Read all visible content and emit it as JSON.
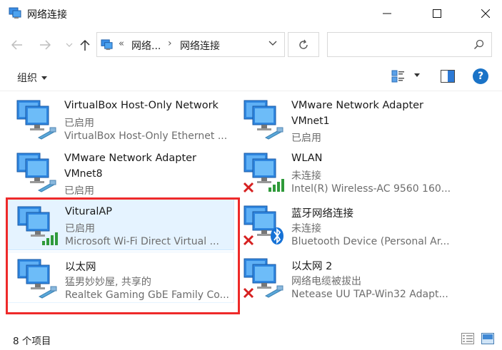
{
  "window": {
    "title": "网络连接",
    "controls": [
      "minimize-icon",
      "maximize-icon",
      "close-icon"
    ]
  },
  "address": {
    "separator": "«",
    "crumbs": [
      "网络...",
      "网络连接"
    ],
    "chevron": "›"
  },
  "search": {
    "placeholder": "",
    "value": ""
  },
  "toolbar": {
    "organize_label": "组织",
    "help_label": "?"
  },
  "colors": {
    "highlight_border": "#ee2a2a",
    "selection_bg": "#e5f3ff",
    "help_blue": "#1a73c7"
  },
  "items": [
    {
      "name": "VirtualBox Host-Only Network",
      "status": "已启用",
      "device": "VirtualBox Host-Only Ethernet ...",
      "icon": "ethernet-adapter-icon",
      "state": "enabled"
    },
    {
      "name": "VMware Network Adapter",
      "name2": "VMnet1",
      "status": "已启用",
      "icon": "ethernet-adapter-icon",
      "state": "enabled"
    },
    {
      "name": "VMware Network Adapter",
      "name2": "VMnet8",
      "status": "已启用",
      "icon": "ethernet-adapter-icon",
      "state": "enabled"
    },
    {
      "name": "WLAN",
      "status": "未连接",
      "device": "Intel(R) Wireless-AC 9560 160...",
      "icon": "wifi-adapter-icon",
      "state": "disconnected"
    },
    {
      "name": "VituralAP",
      "status": "已启用",
      "device": "Microsoft Wi-Fi Direct Virtual ...",
      "icon": "wifi-adapter-icon",
      "state": "enabled"
    },
    {
      "name": "蓝牙网络连接",
      "status": "未连接",
      "device": "Bluetooth Device (Personal Ar...",
      "icon": "bluetooth-adapter-icon",
      "state": "disconnected"
    },
    {
      "name": "以太网",
      "status": "猛男妙妙屋, 共享的",
      "device": "Realtek Gaming GbE Family Co...",
      "icon": "ethernet-adapter-icon",
      "state": "enabled"
    },
    {
      "name": "以太网 2",
      "status": "网络电缆被拔出",
      "device": "Netease UU TAP-Win32 Adapt...",
      "icon": "ethernet-adapter-icon",
      "state": "disconnected"
    }
  ],
  "status": {
    "count_text": "8 个项目"
  }
}
